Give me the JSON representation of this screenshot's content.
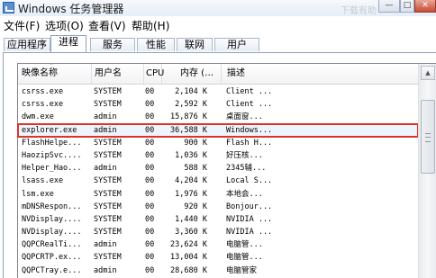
{
  "window": {
    "title": "Windows 任务管理器",
    "ghost_text": "下载有助",
    "minimize_glyph": "—",
    "maximize_glyph": "□",
    "close_glyph": "✕"
  },
  "menu": [
    "文件(F)",
    "选项(O)",
    "查看(V)",
    "帮助(H)"
  ],
  "tabs": [
    "应用程序",
    "进程",
    "服务",
    "性能",
    "联网",
    "用户"
  ],
  "active_tab": "进程",
  "columns": {
    "name": "映像名称",
    "user": "用户名",
    "cpu": "CPU",
    "mem": "内存 (…",
    "desc": "描述"
  },
  "processes": [
    {
      "name": "csrss.exe",
      "user": "SYSTEM",
      "cpu": "00",
      "mem": "2,104 K",
      "desc": "Client ..."
    },
    {
      "name": "csrss.exe",
      "user": "SYSTEM",
      "cpu": "00",
      "mem": "2,592 K",
      "desc": "Client ..."
    },
    {
      "name": "dwm.exe",
      "user": "admin",
      "cpu": "00",
      "mem": "15,876 K",
      "desc": "桌面窗..."
    },
    {
      "name": "explorer.exe",
      "user": "admin",
      "cpu": "00",
      "mem": "36,588 K",
      "desc": "Windows..."
    },
    {
      "name": "FlashHelpe...",
      "user": "SYSTEM",
      "cpu": "00",
      "mem": "900 K",
      "desc": "Flash H..."
    },
    {
      "name": "HaozipSvc....",
      "user": "SYSTEM",
      "cpu": "00",
      "mem": "1,036 K",
      "desc": "好压核..."
    },
    {
      "name": "Helper_Hao...",
      "user": "admin",
      "cpu": "00",
      "mem": "588 K",
      "desc": "2345辅..."
    },
    {
      "name": "lsass.exe",
      "user": "SYSTEM",
      "cpu": "00",
      "mem": "4,204 K",
      "desc": "Local S..."
    },
    {
      "name": "lsm.exe",
      "user": "SYSTEM",
      "cpu": "00",
      "mem": "1,976 K",
      "desc": "本地会..."
    },
    {
      "name": "mDNSRespon...",
      "user": "SYSTEM",
      "cpu": "00",
      "mem": "920 K",
      "desc": "Bonjour..."
    },
    {
      "name": "NVDisplay....",
      "user": "SYSTEM",
      "cpu": "00",
      "mem": "1,440 K",
      "desc": "NVIDIA ..."
    },
    {
      "name": "NVDisplay....",
      "user": "SYSTEM",
      "cpu": "00",
      "mem": "3,360 K",
      "desc": "NVIDIA ..."
    },
    {
      "name": "QQPCRealTi...",
      "user": "admin",
      "cpu": "00",
      "mem": "23,624 K",
      "desc": "电脑管..."
    },
    {
      "name": "QQPCRTP.ex...",
      "user": "SYSTEM",
      "cpu": "00",
      "mem": "13,004 K",
      "desc": "电脑管..."
    },
    {
      "name": "QQPCTray.e...",
      "user": "admin",
      "cpu": "00",
      "mem": "28,680 K",
      "desc": "电脑管家"
    }
  ],
  "selected_process": "explorer.exe",
  "scrollbar": {
    "up_glyph": "▲"
  },
  "colors": {
    "selection_outline": "#d9342b",
    "title_bar": "#e4ecf6"
  }
}
